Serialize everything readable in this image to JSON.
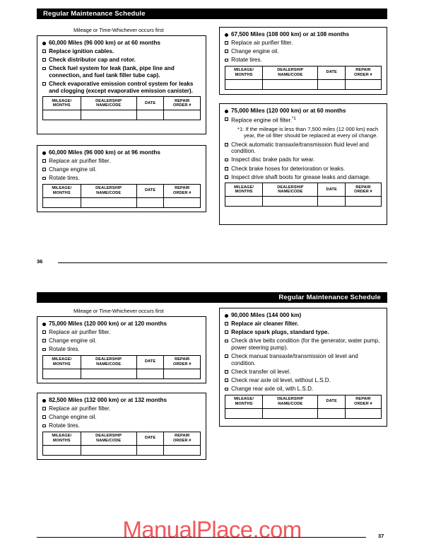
{
  "document": {
    "header_title": "Regular Maintenance Schedule",
    "caption": "Mileage or Time-Whichever occurs first",
    "watermark": "ManualPlace.com",
    "table_headers": {
      "mileage": "MILEAGE/\nMONTHS",
      "mileage_l1": "MILEAGE/",
      "mileage_l2": "MONTHS",
      "dealership_l1": "DEALERSHIP",
      "dealership_l2": "NAME/CODE",
      "date": "DATE",
      "repair_l1": "REPAIR",
      "repair_l2": "ORDER #"
    }
  },
  "pages": [
    {
      "folio": "36",
      "folio_side": "left",
      "header_align": "left",
      "boxes": [
        {
          "id": "box-60000-60mo",
          "title": "60,000 Miles (96 000 km) or at 60 months",
          "items": [
            {
              "text": "Replace ignition cables.",
              "bold": true
            },
            {
              "text": "Check distributor cap and rotor.",
              "bold": true
            },
            {
              "text": "Check fuel system for leak (tank, pipe line and connection, and fuel tank filler tube cap).",
              "bold": true
            },
            {
              "text": "Check evaporative emission control system for leaks and clogging (except evaporative emission canister).",
              "bold": true
            }
          ]
        },
        {
          "id": "box-60000-96mo",
          "title": "60,000 Miles (96 000 km) or at 96 months",
          "items": [
            {
              "text": "Replace air purifier filter.",
              "bold": false
            },
            {
              "text": "Change engine oil.",
              "bold": false
            },
            {
              "text": "Rotate tires.",
              "bold": false
            }
          ]
        },
        {
          "id": "box-67500-108mo",
          "title": "67,500 Miles (108 000 km) or at 108 months",
          "items": [
            {
              "text": "Replace air purifier filter.",
              "bold": false
            },
            {
              "text": "Change engine oil.",
              "bold": false
            },
            {
              "text": "Rotate tires.",
              "bold": false
            }
          ]
        },
        {
          "id": "box-75000-60mo",
          "title": "75,000 Miles (120 000 km) or at 60 months",
          "items": [
            {
              "text": "Replace engine oil filter.",
              "sup": "*1",
              "bold": false,
              "note": "*1: If the mileage is less than 7,500 miles (12 000 km) each year, the oil filter should be replaced at every oil change."
            },
            {
              "text": "Check automatic transaxle/transmission fluid level and condition.",
              "bold": false
            },
            {
              "text": "Inspect disc brake pads for wear.",
              "bold": false
            },
            {
              "text": "Check brake hoses for deterioration or leaks.",
              "bold": false
            },
            {
              "text": "Inspect drive shaft boots for grease leaks and damage.",
              "bold": false
            }
          ]
        }
      ]
    },
    {
      "folio": "37",
      "folio_side": "right",
      "header_align": "right",
      "boxes": [
        {
          "id": "box-75000-120mo",
          "title": "75,000 Miles (120 000 km) or at 120 months",
          "items": [
            {
              "text": "Replace air purifier filter.",
              "bold": false
            },
            {
              "text": "Change engine oil.",
              "bold": false
            },
            {
              "text": "Rotate tires.",
              "bold": false
            }
          ]
        },
        {
          "id": "box-82500-132mo",
          "title": "82,500 Miles (132 000 km) or at 132 months",
          "items": [
            {
              "text": "Replace air purifier filter.",
              "bold": false
            },
            {
              "text": "Change engine oil.",
              "bold": false
            },
            {
              "text": "Rotate tires.",
              "bold": false
            }
          ]
        },
        {
          "id": "box-90000",
          "title": "90,000 Miles (144 000 km)",
          "items": [
            {
              "text": "Replace air cleaner filter.",
              "bold": true
            },
            {
              "text": "Replace spark plugs, standard type.",
              "bold": true
            },
            {
              "text": "Check drive belts condition (for the generator, water pump, power steering pump).",
              "bold": false
            },
            {
              "text": "Check manual transaxle/transmission oil level and condition.",
              "bold": false
            },
            {
              "text": "Check transfer oil level.",
              "bold": false
            },
            {
              "text": "Check rear axle oil level, without L.S.D.",
              "bold": false
            },
            {
              "text": "Change rear axle oil, with L.S.D.",
              "bold": false
            }
          ]
        }
      ]
    }
  ],
  "colors": {
    "header_bg": "#000000",
    "header_text": "#ffffff",
    "watermark": "#f1585c",
    "rule": "#000000"
  }
}
